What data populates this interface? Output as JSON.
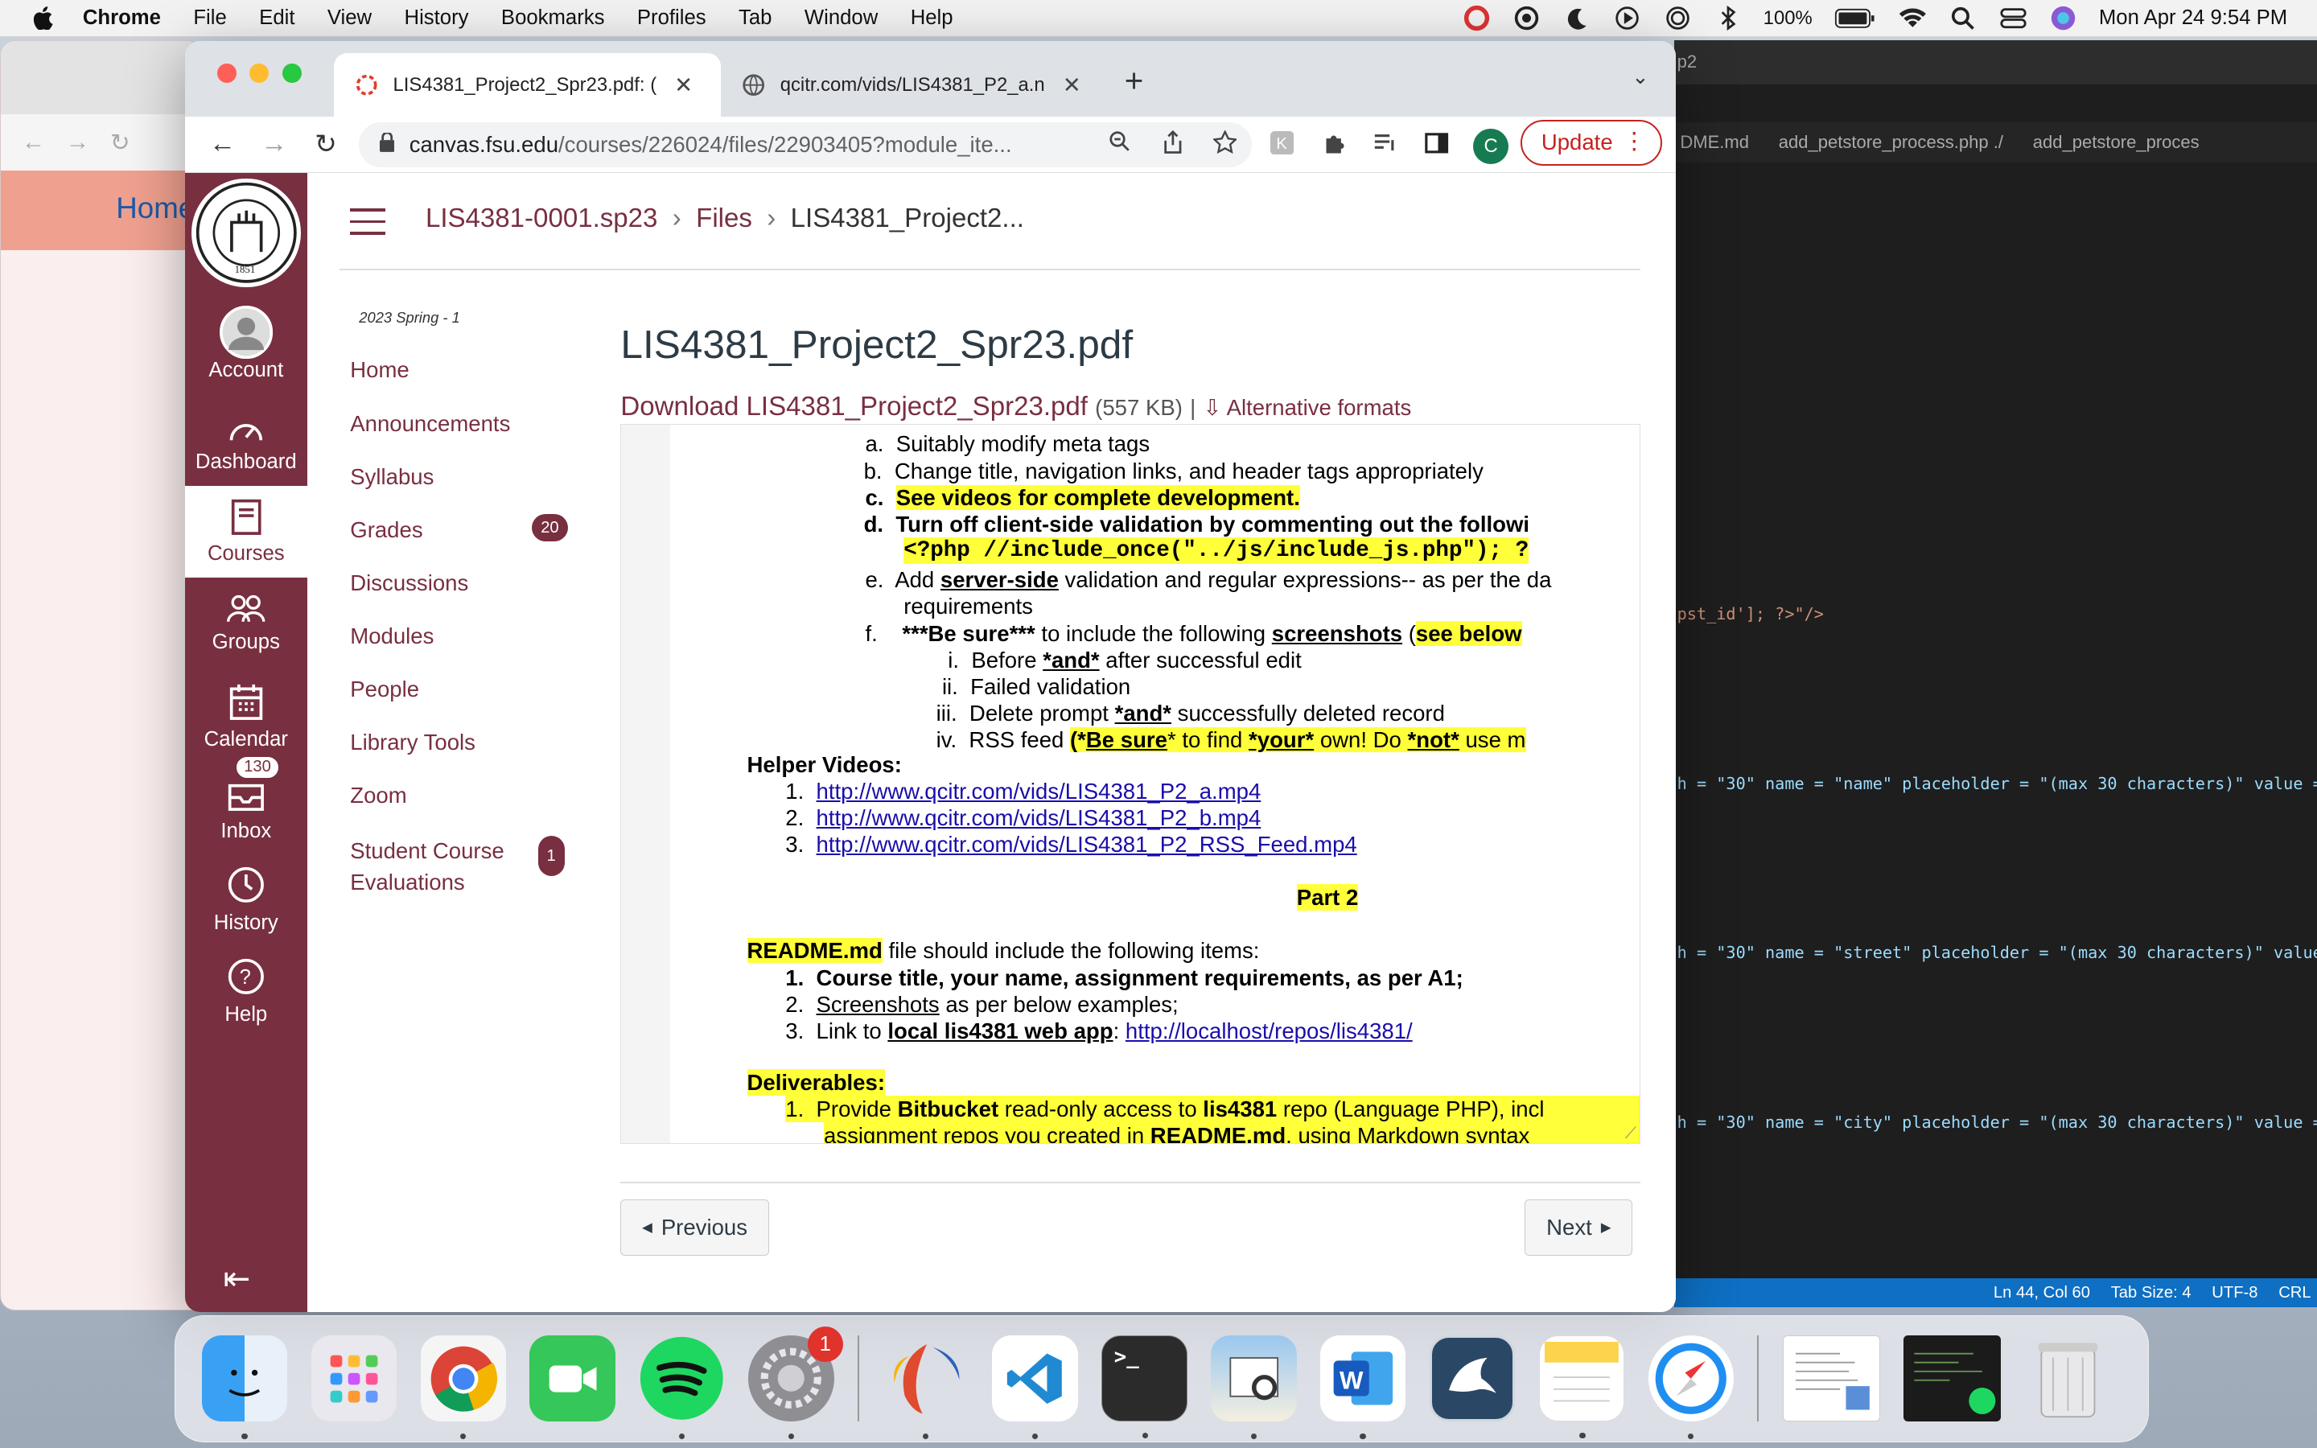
{
  "menubar": {
    "app": "Chrome",
    "items": [
      "File",
      "Edit",
      "View",
      "History",
      "Bookmarks",
      "Profiles",
      "Tab",
      "Window",
      "Help"
    ],
    "battery": "100%",
    "clock": "Mon Apr 24  9:54 PM"
  },
  "editor": {
    "title_fragment": "p2",
    "tabs": [
      "DME.md",
      "add_petstore_process.php ./",
      "add_petstore_proces"
    ],
    "lines": [
      {
        "text": "pst_id']; ?>\"/>"
      },
      {
        "text": "h = \"30\" name = \"name\" placeholder = \"(max 30 characters)\" value ="
      },
      {
        "text": "h = \"30\" name = \"street\" placeholder = \"(max 30 characters)\" value"
      },
      {
        "text": "h = \"30\" name = \"city\" placeholder = \"(max 30 characters)\" value ="
      }
    ],
    "status": {
      "pos": "Ln 44, Col 60",
      "tab": "Tab Size: 4",
      "enc": "UTF-8",
      "eol": "CRL"
    }
  },
  "backwin": {
    "home": "Home"
  },
  "browser": {
    "tabs": [
      {
        "title": "LIS4381_Project2_Spr23.pdf: ("
      },
      {
        "title": "qcitr.com/vids/LIS4381_P2_a.n"
      }
    ],
    "url_host": "canvas.fsu.edu",
    "url_path": "/courses/226024/files/22903405?module_ite...",
    "profile_initial": "C",
    "update_label": "Update"
  },
  "globalnav": {
    "items": [
      {
        "label": "Account"
      },
      {
        "label": "Dashboard"
      },
      {
        "label": "Courses"
      },
      {
        "label": "Groups"
      },
      {
        "label": "Calendar"
      },
      {
        "label": "Inbox",
        "badge": "130"
      },
      {
        "label": "History"
      },
      {
        "label": "Help"
      }
    ]
  },
  "crumbs": {
    "course": "LIS4381-0001.sp23",
    "files": "Files",
    "current": "LIS4381_Project2..."
  },
  "term": "2023 Spring - 1",
  "coursenav": [
    {
      "label": "Home"
    },
    {
      "label": "Announcements"
    },
    {
      "label": "Syllabus"
    },
    {
      "label": "Grades",
      "badge": "20"
    },
    {
      "label": "Discussions"
    },
    {
      "label": "Modules"
    },
    {
      "label": "People"
    },
    {
      "label": "Library Tools"
    },
    {
      "label": "Zoom"
    },
    {
      "label": "Student Course Evaluations",
      "badge": "1"
    }
  ],
  "file": {
    "title": "LIS4381_Project2_Spr23.pdf",
    "download": "Download LIS4381_Project2_Spr23.pdf",
    "size": "(557 KB)",
    "sep": "|",
    "alt": "Alternative formats"
  },
  "pdf": {
    "la": "a.",
    "ta": "Suitably modify meta tags",
    "lb": "b.",
    "tb": "Change title, navigation links, and header tags appropriately",
    "lc": "c.",
    "tc": "See videos for complete development.",
    "ld": "d.",
    "td": "Turn off client-side validation by commenting out the followi",
    "code": "<?php //include_once(\"../js/include_js.php\"); ?",
    "le": "e.",
    "te1": "Add ",
    "te2": "server-side",
    "te3": " validation and regular expressions-- as per the da",
    "te4": "requirements",
    "lf": "f.",
    "tf1": "***Be sure***",
    "tf2": " to include the following ",
    "tf3": "screenshots",
    "tf4": " (",
    "tf5": "see below",
    "li": "i.",
    "ti1": "Before ",
    "ti2": "*and*",
    "ti3": " after successful edit",
    "lii": "ii.",
    "tii": "Failed validation",
    "liii": "iii.",
    "tiii1": "Delete prompt ",
    "tiii2": "*and*",
    "tiii3": " successfully deleted record",
    "liv": "iv.",
    "tiv1": "RSS feed ",
    "tiv2": "(*",
    "tiv3": "Be sure",
    "tiv4": "* to find ",
    "tiv5": "*your*",
    "tiv6": " own! Do ",
    "tiv7": "*not*",
    "tiv8": " use m",
    "helper": "Helper Videos:",
    "v1n": "1.",
    "v1": "http://www.qcitr.com/vids/LIS4381_P2_a.mp4",
    "v2n": "2.",
    "v2": "http://www.qcitr.com/vids/LIS4381_P2_b.mp4",
    "v3n": "3.",
    "v3": "http://www.qcitr.com/vids/LIS4381_P2_RSS_Feed.mp4",
    "part2": "Part 2",
    "readme1": "README.md",
    "readme2": " file should include the following items:",
    "r1n": "1.",
    "r1": "Course title, your name, assignment requirements, as per A1;",
    "r2n": "2.",
    "r2a": "Screenshots",
    "r2b": " as per below examples;",
    "r3n": "3.",
    "r3a": "Link to ",
    "r3b": "local lis4381 web app",
    "r3c": ": ",
    "r3d": "http://localhost/repos/lis4381/",
    "deliv": "Deliverables:",
    "d1n": "1.",
    "d1a": "Provide ",
    "d1b": "Bitbucket",
    "d1c": " read-only access to ",
    "d1d": "lis4381",
    "d1e": " repo (Language PHP), incl",
    "d2a": "assignment repos you created in ",
    "d2b": "README.md",
    "d2c": ", using ",
    "d2d": "Markdown",
    "d2e": " syntax"
  },
  "pager": {
    "prev": "Previous",
    "next": "Next"
  },
  "dock": {
    "settings_badge": "1"
  },
  "colors": {
    "garnet": "#782f40",
    "highlight": "#ffff3a",
    "link": "#1a0dab"
  }
}
